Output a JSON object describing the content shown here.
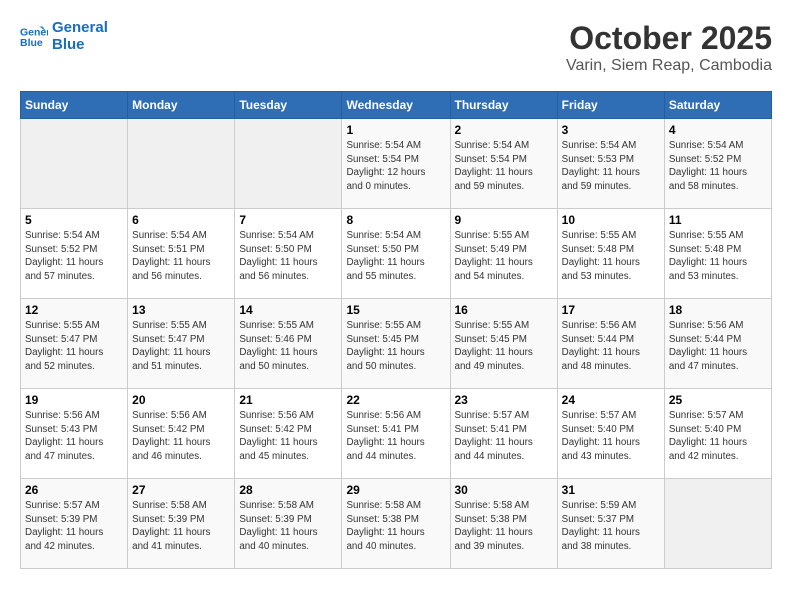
{
  "header": {
    "logo_line1": "General",
    "logo_line2": "Blue",
    "title": "October 2025",
    "subtitle": "Varin, Siem Reap, Cambodia"
  },
  "weekdays": [
    "Sunday",
    "Monday",
    "Tuesday",
    "Wednesday",
    "Thursday",
    "Friday",
    "Saturday"
  ],
  "weeks": [
    [
      {
        "day": "",
        "info": ""
      },
      {
        "day": "",
        "info": ""
      },
      {
        "day": "",
        "info": ""
      },
      {
        "day": "1",
        "info": "Sunrise: 5:54 AM\nSunset: 5:54 PM\nDaylight: 12 hours\nand 0 minutes."
      },
      {
        "day": "2",
        "info": "Sunrise: 5:54 AM\nSunset: 5:54 PM\nDaylight: 11 hours\nand 59 minutes."
      },
      {
        "day": "3",
        "info": "Sunrise: 5:54 AM\nSunset: 5:53 PM\nDaylight: 11 hours\nand 59 minutes."
      },
      {
        "day": "4",
        "info": "Sunrise: 5:54 AM\nSunset: 5:52 PM\nDaylight: 11 hours\nand 58 minutes."
      }
    ],
    [
      {
        "day": "5",
        "info": "Sunrise: 5:54 AM\nSunset: 5:52 PM\nDaylight: 11 hours\nand 57 minutes."
      },
      {
        "day": "6",
        "info": "Sunrise: 5:54 AM\nSunset: 5:51 PM\nDaylight: 11 hours\nand 56 minutes."
      },
      {
        "day": "7",
        "info": "Sunrise: 5:54 AM\nSunset: 5:50 PM\nDaylight: 11 hours\nand 56 minutes."
      },
      {
        "day": "8",
        "info": "Sunrise: 5:54 AM\nSunset: 5:50 PM\nDaylight: 11 hours\nand 55 minutes."
      },
      {
        "day": "9",
        "info": "Sunrise: 5:55 AM\nSunset: 5:49 PM\nDaylight: 11 hours\nand 54 minutes."
      },
      {
        "day": "10",
        "info": "Sunrise: 5:55 AM\nSunset: 5:48 PM\nDaylight: 11 hours\nand 53 minutes."
      },
      {
        "day": "11",
        "info": "Sunrise: 5:55 AM\nSunset: 5:48 PM\nDaylight: 11 hours\nand 53 minutes."
      }
    ],
    [
      {
        "day": "12",
        "info": "Sunrise: 5:55 AM\nSunset: 5:47 PM\nDaylight: 11 hours\nand 52 minutes."
      },
      {
        "day": "13",
        "info": "Sunrise: 5:55 AM\nSunset: 5:47 PM\nDaylight: 11 hours\nand 51 minutes."
      },
      {
        "day": "14",
        "info": "Sunrise: 5:55 AM\nSunset: 5:46 PM\nDaylight: 11 hours\nand 50 minutes."
      },
      {
        "day": "15",
        "info": "Sunrise: 5:55 AM\nSunset: 5:45 PM\nDaylight: 11 hours\nand 50 minutes."
      },
      {
        "day": "16",
        "info": "Sunrise: 5:55 AM\nSunset: 5:45 PM\nDaylight: 11 hours\nand 49 minutes."
      },
      {
        "day": "17",
        "info": "Sunrise: 5:56 AM\nSunset: 5:44 PM\nDaylight: 11 hours\nand 48 minutes."
      },
      {
        "day": "18",
        "info": "Sunrise: 5:56 AM\nSunset: 5:44 PM\nDaylight: 11 hours\nand 47 minutes."
      }
    ],
    [
      {
        "day": "19",
        "info": "Sunrise: 5:56 AM\nSunset: 5:43 PM\nDaylight: 11 hours\nand 47 minutes."
      },
      {
        "day": "20",
        "info": "Sunrise: 5:56 AM\nSunset: 5:42 PM\nDaylight: 11 hours\nand 46 minutes."
      },
      {
        "day": "21",
        "info": "Sunrise: 5:56 AM\nSunset: 5:42 PM\nDaylight: 11 hours\nand 45 minutes."
      },
      {
        "day": "22",
        "info": "Sunrise: 5:56 AM\nSunset: 5:41 PM\nDaylight: 11 hours\nand 44 minutes."
      },
      {
        "day": "23",
        "info": "Sunrise: 5:57 AM\nSunset: 5:41 PM\nDaylight: 11 hours\nand 44 minutes."
      },
      {
        "day": "24",
        "info": "Sunrise: 5:57 AM\nSunset: 5:40 PM\nDaylight: 11 hours\nand 43 minutes."
      },
      {
        "day": "25",
        "info": "Sunrise: 5:57 AM\nSunset: 5:40 PM\nDaylight: 11 hours\nand 42 minutes."
      }
    ],
    [
      {
        "day": "26",
        "info": "Sunrise: 5:57 AM\nSunset: 5:39 PM\nDaylight: 11 hours\nand 42 minutes."
      },
      {
        "day": "27",
        "info": "Sunrise: 5:58 AM\nSunset: 5:39 PM\nDaylight: 11 hours\nand 41 minutes."
      },
      {
        "day": "28",
        "info": "Sunrise: 5:58 AM\nSunset: 5:39 PM\nDaylight: 11 hours\nand 40 minutes."
      },
      {
        "day": "29",
        "info": "Sunrise: 5:58 AM\nSunset: 5:38 PM\nDaylight: 11 hours\nand 40 minutes."
      },
      {
        "day": "30",
        "info": "Sunrise: 5:58 AM\nSunset: 5:38 PM\nDaylight: 11 hours\nand 39 minutes."
      },
      {
        "day": "31",
        "info": "Sunrise: 5:59 AM\nSunset: 5:37 PM\nDaylight: 11 hours\nand 38 minutes."
      },
      {
        "day": "",
        "info": ""
      }
    ]
  ]
}
